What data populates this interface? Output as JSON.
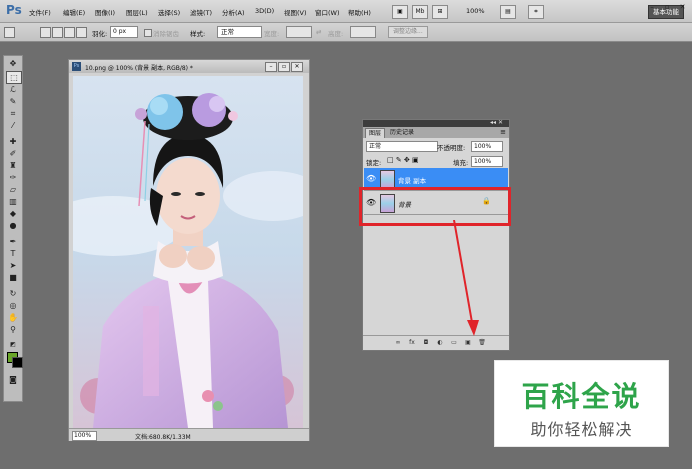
{
  "app_logo": "Ps",
  "menu": [
    "文件(F)",
    "编辑(E)",
    "图像(I)",
    "图层(L)",
    "选择(S)",
    "滤镜(T)",
    "分析(A)",
    "3D(D)",
    "视图(V)",
    "窗口(W)",
    "帮助(H)"
  ],
  "menubar": {
    "zoom": "100%",
    "workspace_label": "基本功能",
    "mb_label": "Mb"
  },
  "options": {
    "feather_label": "羽化:",
    "feather_value": "0 px",
    "antialias_label": "消除锯齿",
    "style_label": "样式:",
    "style_value": "正常",
    "width_label": "宽度:",
    "height_label": "高度:",
    "refine_edge": "调整边缘..."
  },
  "document": {
    "title": "10.png @ 100% (背景 副本, RGB/8) *",
    "zoom": "100%",
    "info": "文档:680.8K/1.33M"
  },
  "layers_panel": {
    "tab_layers": "图层",
    "tab_history": "历史记录",
    "blend_mode": "正常",
    "opacity_label": "不透明度:",
    "opacity_value": "100%",
    "lock_label": "锁定:",
    "fill_label": "填充:",
    "fill_value": "100%",
    "layers": [
      {
        "name": "背景 副本",
        "selected": true
      },
      {
        "name": "背景",
        "selected": false,
        "locked": true
      }
    ]
  },
  "watermark": {
    "title": "百科全说",
    "subtitle": "助你轻松解决"
  },
  "colors": {
    "foreground": "#6aa629",
    "background": "#000000",
    "highlight": "#e0242a",
    "selected_layer": "#3a8df5"
  }
}
